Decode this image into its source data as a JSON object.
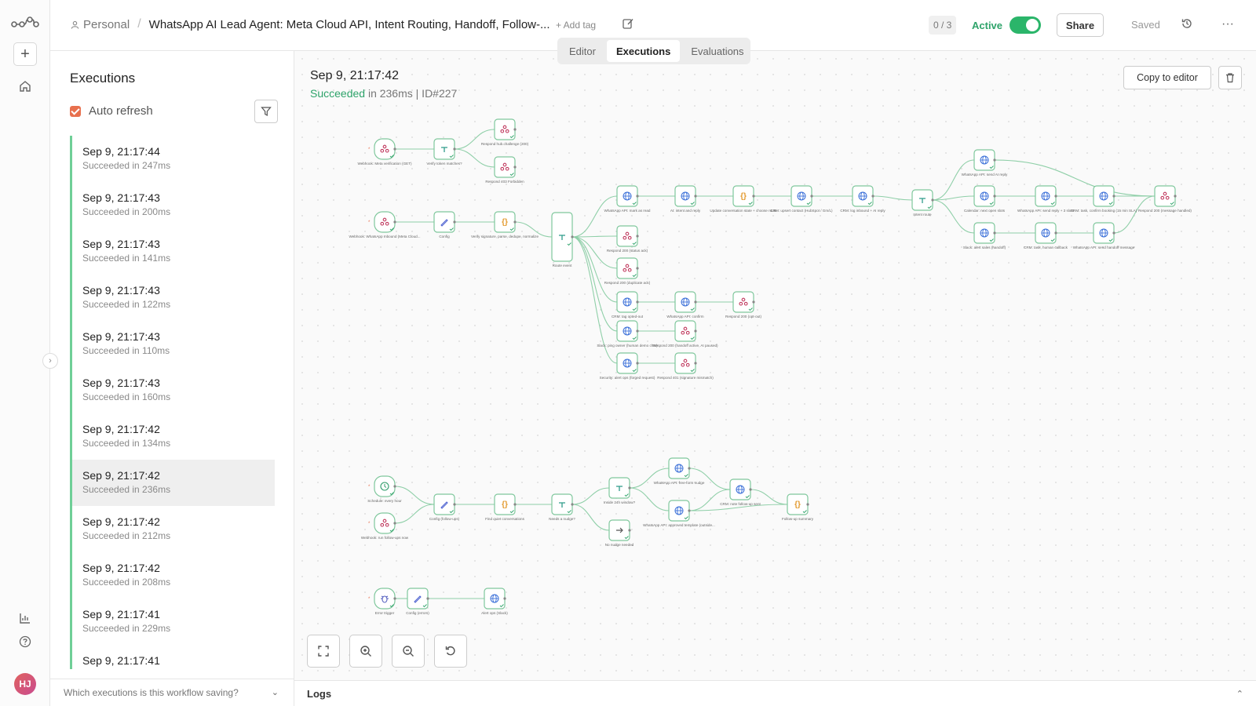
{
  "header": {
    "project": "Personal",
    "workflow_title": "WhatsApp AI Lead Agent: Meta Cloud API, Intent Routing, Handoff, Follow-...",
    "add_tag": "+ Add tag",
    "counter": "0 / 3",
    "active_label": "Active",
    "active": true,
    "share_label": "Share",
    "saved_label": "Saved"
  },
  "tabs": [
    "Editor",
    "Executions",
    "Evaluations"
  ],
  "active_tab": "Executions",
  "panel": {
    "title": "Executions",
    "auto_refresh_label": "Auto refresh",
    "auto_refresh": true,
    "executions": [
      {
        "time": "Sep 9, 21:17:44",
        "status": "Succeeded in 247ms"
      },
      {
        "time": "Sep 9, 21:17:43",
        "status": "Succeeded in 200ms"
      },
      {
        "time": "Sep 9, 21:17:43",
        "status": "Succeeded in 141ms"
      },
      {
        "time": "Sep 9, 21:17:43",
        "status": "Succeeded in 122ms"
      },
      {
        "time": "Sep 9, 21:17:43",
        "status": "Succeeded in 110ms"
      },
      {
        "time": "Sep 9, 21:17:43",
        "status": "Succeeded in 160ms"
      },
      {
        "time": "Sep 9, 21:17:42",
        "status": "Succeeded in 134ms"
      },
      {
        "time": "Sep 9, 21:17:42",
        "status": "Succeeded in 236ms",
        "selected": true
      },
      {
        "time": "Sep 9, 21:17:42",
        "status": "Succeeded in 212ms"
      },
      {
        "time": "Sep 9, 21:17:42",
        "status": "Succeeded in 208ms"
      },
      {
        "time": "Sep 9, 21:17:41",
        "status": "Succeeded in 229ms"
      },
      {
        "time": "Sep 9, 21:17:41",
        "status": ""
      }
    ],
    "saving_question": "Which executions is this workflow saving?"
  },
  "execution": {
    "date": "Sep 9, 21:17:42",
    "status_word": "Succeeded",
    "duration": " in 236ms",
    "id_text": " | ID#227",
    "copy_label": "Copy to editor"
  },
  "logs_label": "Logs",
  "colors": {
    "accent": "#e8704e",
    "success": "#2ea36a",
    "edge": "#8fcfa8"
  },
  "nodes": [
    {
      "id": "wh_meta",
      "label": "Webhook: Meta verification (GET)",
      "icon": "webhook",
      "trigger": true
    },
    {
      "id": "verify_tok",
      "label": "Verify token matches?",
      "icon": "if"
    },
    {
      "id": "resp_hub",
      "label": "Respond hub.challenge (200)",
      "icon": "webhook"
    },
    {
      "id": "resp_403",
      "label": "Respond 403 Forbidden",
      "icon": "webhook"
    },
    {
      "id": "wh_inbound",
      "label": "Webhook: WhatsApp Inbound (Meta Cloud...",
      "icon": "webhook",
      "trigger": true
    },
    {
      "id": "config",
      "label": "Config",
      "icon": "edit"
    },
    {
      "id": "verify_sig",
      "label": "Verify signature, parse, dedupe, normalize",
      "icon": "code"
    },
    {
      "id": "route_event",
      "label": "Route event",
      "icon": "switch"
    },
    {
      "id": "wa_read",
      "label": "WhatsApp API: mark as read",
      "icon": "http"
    },
    {
      "id": "ai_intent",
      "label": "AI: intent and reply",
      "icon": "http"
    },
    {
      "id": "update_conv",
      "label": "Update conversation state + choose route",
      "icon": "code"
    },
    {
      "id": "crm_upsert",
      "label": "CRM: upsert contact (HubSpot / Gm/L)",
      "icon": "http"
    },
    {
      "id": "crm_log_in",
      "label": "CRM: log inbound + AI reply",
      "icon": "http"
    },
    {
      "id": "intent_route",
      "label": "Intent route",
      "icon": "switch"
    },
    {
      "id": "wa_send_ai",
      "label": "WhatsApp API: send AI reply",
      "icon": "http"
    },
    {
      "id": "cal_slots",
      "label": "Calendar: next open slots",
      "icon": "http"
    },
    {
      "id": "wa_slots",
      "label": "WhatsApp API: send reply + 3 slots",
      "icon": "http"
    },
    {
      "id": "crm_task_book",
      "label": "CRM: task, confirm booking (15 min SLA)",
      "icon": "http"
    },
    {
      "id": "resp_handled",
      "label": "Respond 200 (message handled)",
      "icon": "webhook"
    },
    {
      "id": "slack_alert",
      "label": "Slack: alert sales (handoff)",
      "icon": "http"
    },
    {
      "id": "crm_callback",
      "label": "CRM: task, human callback",
      "icon": "http"
    },
    {
      "id": "wa_handoff",
      "label": "WhatsApp API: send handoff message",
      "icon": "http"
    },
    {
      "id": "resp_status",
      "label": "Respond 200 (status ack)",
      "icon": "webhook"
    },
    {
      "id": "resp_dup",
      "label": "Respond 200 (duplicate ack)",
      "icon": "webhook"
    },
    {
      "id": "crm_optout",
      "label": "CRM: tag opted-out",
      "icon": "http"
    },
    {
      "id": "wa_confirm",
      "label": "WhatsApp API: confirm",
      "icon": "http"
    },
    {
      "id": "resp_optout",
      "label": "Respond 200 (opt-out)",
      "icon": "webhook"
    },
    {
      "id": "slack_owner",
      "label": "Slack: ping owner (human demo chat)",
      "icon": "http"
    },
    {
      "id": "resp_paused",
      "label": "Respond 200 (handoff active, AI paused)",
      "icon": "webhook"
    },
    {
      "id": "sec_alert",
      "label": "Security: alert ops (forged request)",
      "icon": "http"
    },
    {
      "id": "resp_401",
      "label": "Respond 401 (signature mismatch)",
      "icon": "webhook"
    },
    {
      "id": "schedule",
      "label": "Schedule: every hour",
      "icon": "clock",
      "trigger": true
    },
    {
      "id": "wh_followups",
      "label": "Webhook: run follow-ups now",
      "icon": "webhook",
      "trigger": true
    },
    {
      "id": "config_fu",
      "label": "Config (follow-ups)",
      "icon": "edit"
    },
    {
      "id": "find_quiet",
      "label": "Find quiet conversations",
      "icon": "code"
    },
    {
      "id": "needs_nudge",
      "label": "Needs a nudge?",
      "icon": "if"
    },
    {
      "id": "inside_24h",
      "label": "Inside 24h window?",
      "icon": "if"
    },
    {
      "id": "no_nudge",
      "label": "No nudge needed",
      "icon": "noop"
    },
    {
      "id": "wa_freeform",
      "label": "WhatsApp API: free-form nudge",
      "icon": "http"
    },
    {
      "id": "wa_template",
      "label": "WhatsApp API: approved template (outside...",
      "icon": "http"
    },
    {
      "id": "crm_note_fu",
      "label": "CRM: note follow-up sent",
      "icon": "http"
    },
    {
      "id": "fu_summary",
      "label": "Follow-up summary",
      "icon": "code"
    },
    {
      "id": "error_trigger",
      "label": "Error trigger",
      "icon": "bug",
      "trigger": true
    },
    {
      "id": "config_errors",
      "label": "Config (errors)",
      "icon": "edit"
    },
    {
      "id": "alert_ops",
      "label": "Alert ops (Slack)",
      "icon": "http"
    }
  ]
}
